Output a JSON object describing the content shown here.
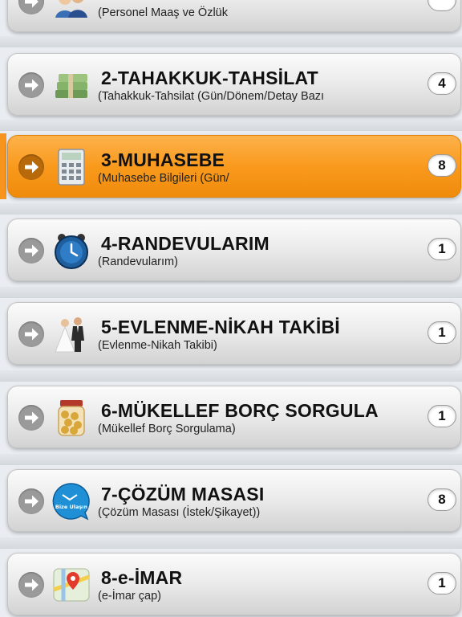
{
  "menu": {
    "items": [
      {
        "title": "",
        "subtitle": "(Personel Maaş ve Özlük",
        "badge": "",
        "icon": "people-icon",
        "active": false
      },
      {
        "title": "2-TAHAKKUK-TAHSİLAT",
        "subtitle": "(Tahakkuk-Tahsilat (Gün/Dönem/Detay Bazı",
        "badge": "4",
        "icon": "money-stack-icon",
        "active": false
      },
      {
        "title": "3-MUHASEBE",
        "subtitle": "(Muhasebe Bilgileri (Gün/",
        "badge": "8",
        "icon": "calculator-icon",
        "active": true
      },
      {
        "title": "4-RANDEVULARIM",
        "subtitle": "(Randevularım)",
        "badge": "1",
        "icon": "alarm-clock-icon",
        "active": false
      },
      {
        "title": "5-EVLENME-NİKAH TAKİBİ",
        "subtitle": "(Evlenme-Nikah Takibi)",
        "badge": "1",
        "icon": "wedding-couple-icon",
        "active": false
      },
      {
        "title": "6-MÜKELLEF BORÇ SORGULA",
        "subtitle": "(Mükellef Borç Sorgulama)",
        "badge": "1",
        "icon": "coin-jar-icon",
        "active": false
      },
      {
        "title": "7-ÇÖZÜM MASASI",
        "subtitle": "(Çözüm Masası (İstek/Şikayet))",
        "badge": "8",
        "icon": "contact-us-icon",
        "active": false,
        "icon_text": "Bize Ulaşın"
      },
      {
        "title": "8-e-İMAR",
        "subtitle": "(e-İmar çap)",
        "badge": "1",
        "icon": "map-pin-icon",
        "active": false
      }
    ]
  },
  "colors": {
    "accent": "#f7941d",
    "background": "#e9edf1"
  }
}
